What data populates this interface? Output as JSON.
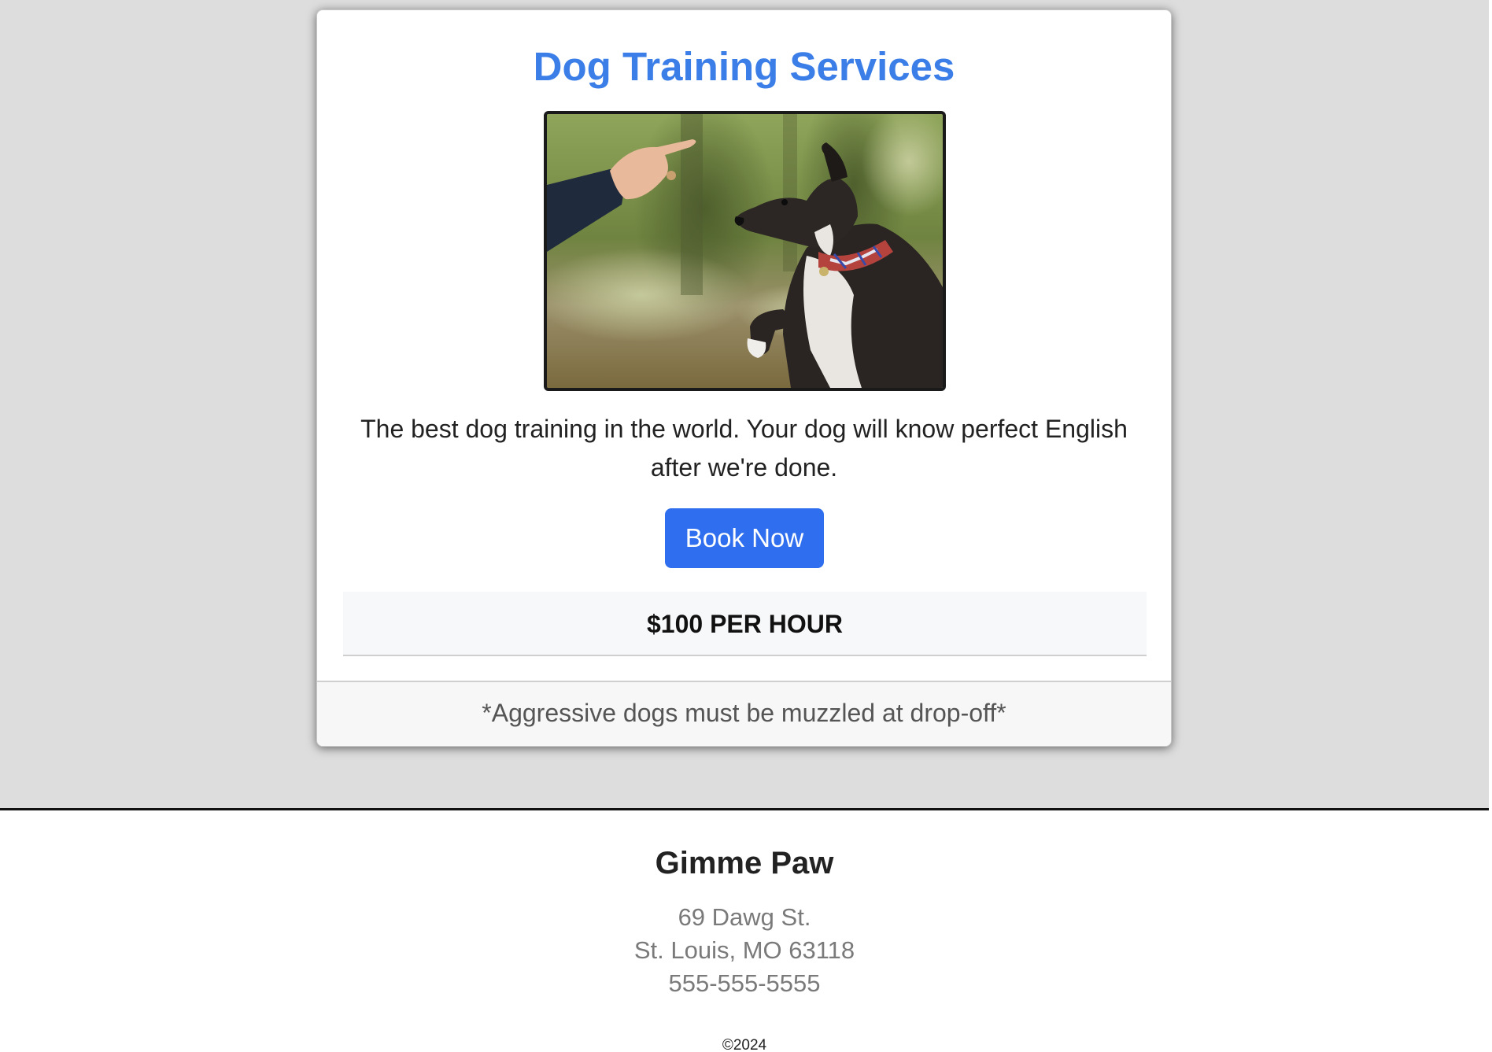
{
  "card": {
    "title": "Dog Training Services",
    "image_alt": "Dog raising its paw toward a hand holding a treat",
    "description": "The best dog training in the world. Your dog will know perfect English after we're done.",
    "button_label": "Book Now",
    "price": "$100 PER HOUR",
    "footer_note": "*Aggressive dogs must be muzzled at drop-off*"
  },
  "footer": {
    "brand": "Gimme Paw",
    "address_line1": "69 Dawg St.",
    "address_line2": "St. Louis, MO 63118",
    "phone": "555-555-5555",
    "copyright": "©2024"
  },
  "colors": {
    "accent": "#3b7ee8",
    "button": "#2f6fef",
    "page_background": "#dddddd"
  }
}
